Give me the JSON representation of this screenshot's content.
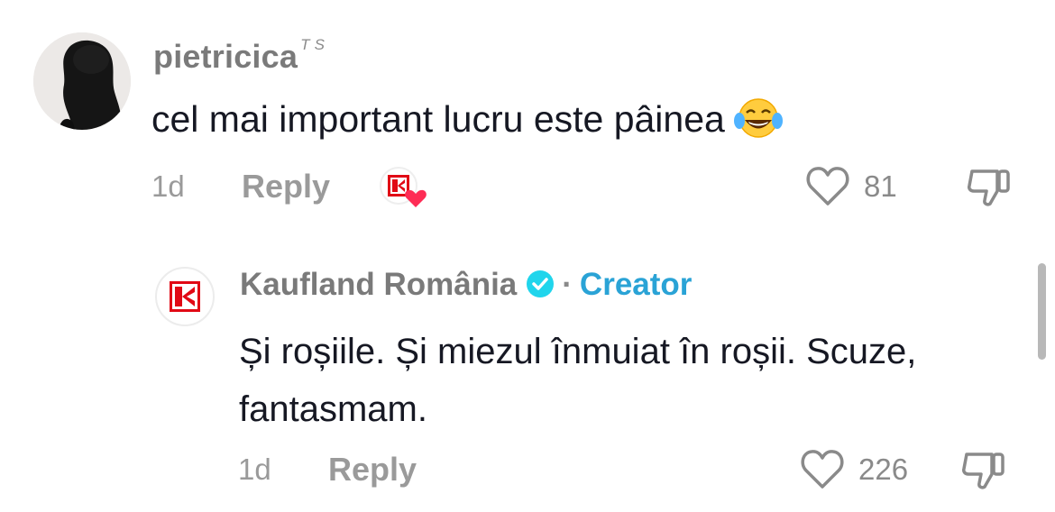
{
  "comment": {
    "username": "pietricica",
    "username_suffix": "T S",
    "text": "cel mai important lucru este pâinea",
    "emoji": "tears-of-joy-emoji",
    "time": "1d",
    "reply_label": "Reply",
    "creator_liked_badge": "creator-liked-heart-badge",
    "likes": "81"
  },
  "reply": {
    "author": "Kaufland România",
    "separator": "·",
    "role": "Creator",
    "text": "Și roșiile. Și miezul înmuiat în roșii. Scuze, fantasmam.",
    "time": "1d",
    "reply_label": "Reply",
    "likes": "226"
  },
  "colors": {
    "brand_red": "#e10915",
    "creator_blue": "#2aa3d6",
    "heart_pink": "#fe2c55",
    "meta_gray": "#9a9a9a",
    "text_dark": "#161823"
  }
}
